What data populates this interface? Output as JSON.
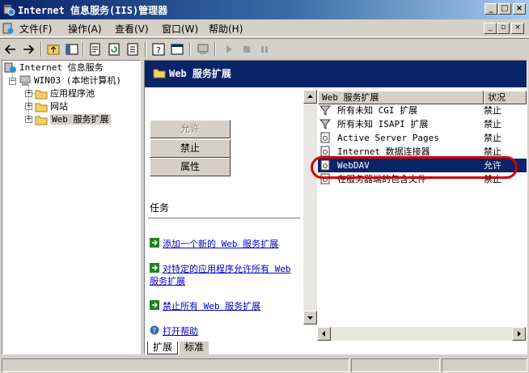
{
  "window": {
    "title": "Internet 信息服务(IIS)管理器"
  },
  "menu": {
    "items": [
      "文件(F)",
      "操作(A)",
      "查看(V)",
      "窗口(W)",
      "帮助(H)"
    ]
  },
  "tree": {
    "root": "Internet 信息服务",
    "server": "WIN03 (本地计算机)",
    "children": [
      "应用程序池",
      "网站",
      "Web 服务扩展"
    ]
  },
  "pane": {
    "header_title": "Web 服务扩展",
    "buttons": {
      "allow": "允许",
      "prohibit": "禁止",
      "properties": "属性"
    },
    "tasks_title": "任务",
    "tasks": [
      "添加一个新的 Web 服务扩展",
      "对特定的应用程序允许所有 Web 服务扩展",
      "禁止所有 Web 服务扩展",
      "打开帮助"
    ]
  },
  "list": {
    "columns": [
      "Web 服务扩展",
      "状况"
    ],
    "rows": [
      {
        "name": "所有未知 CGI 扩展",
        "status": "禁止"
      },
      {
        "name": "所有未知 ISAPI 扩展",
        "status": "禁止"
      },
      {
        "name": "Active Server Pages",
        "status": "禁止"
      },
      {
        "name": "Internet 数据连接器",
        "status": "禁止"
      },
      {
        "name": "WebDAV",
        "status": "允许"
      },
      {
        "name": "在服务器端的包含文件",
        "status": "禁止"
      }
    ],
    "selected_row": "WebDAV"
  },
  "tabs": [
    "扩展",
    "标准"
  ],
  "colors": {
    "title_dark": "#0a246a",
    "highlight_ring": "#d40000",
    "face": "#d4d0c8"
  }
}
